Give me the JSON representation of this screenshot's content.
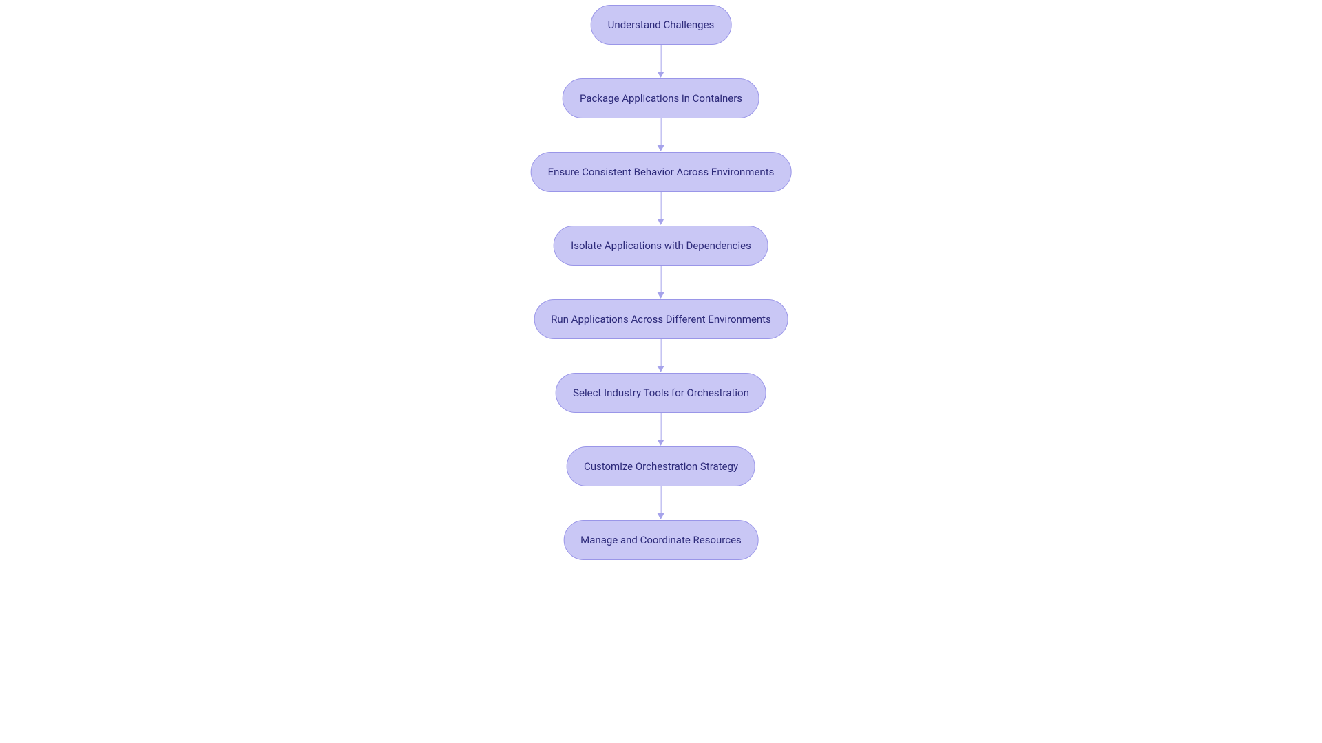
{
  "flowchart": {
    "nodes": [
      {
        "label": "Understand Challenges"
      },
      {
        "label": "Package Applications in Containers"
      },
      {
        "label": "Ensure Consistent Behavior Across Environments"
      },
      {
        "label": "Isolate Applications with Dependencies"
      },
      {
        "label": "Run Applications Across Different Environments"
      },
      {
        "label": "Select Industry Tools for Orchestration"
      },
      {
        "label": "Customize Orchestration Strategy"
      },
      {
        "label": "Manage and Coordinate Resources"
      }
    ],
    "colors": {
      "node_fill": "#c9c7f5",
      "node_border": "#9a96e8",
      "node_text": "#2d2a7a",
      "arrow": "#a6a3eb"
    }
  }
}
